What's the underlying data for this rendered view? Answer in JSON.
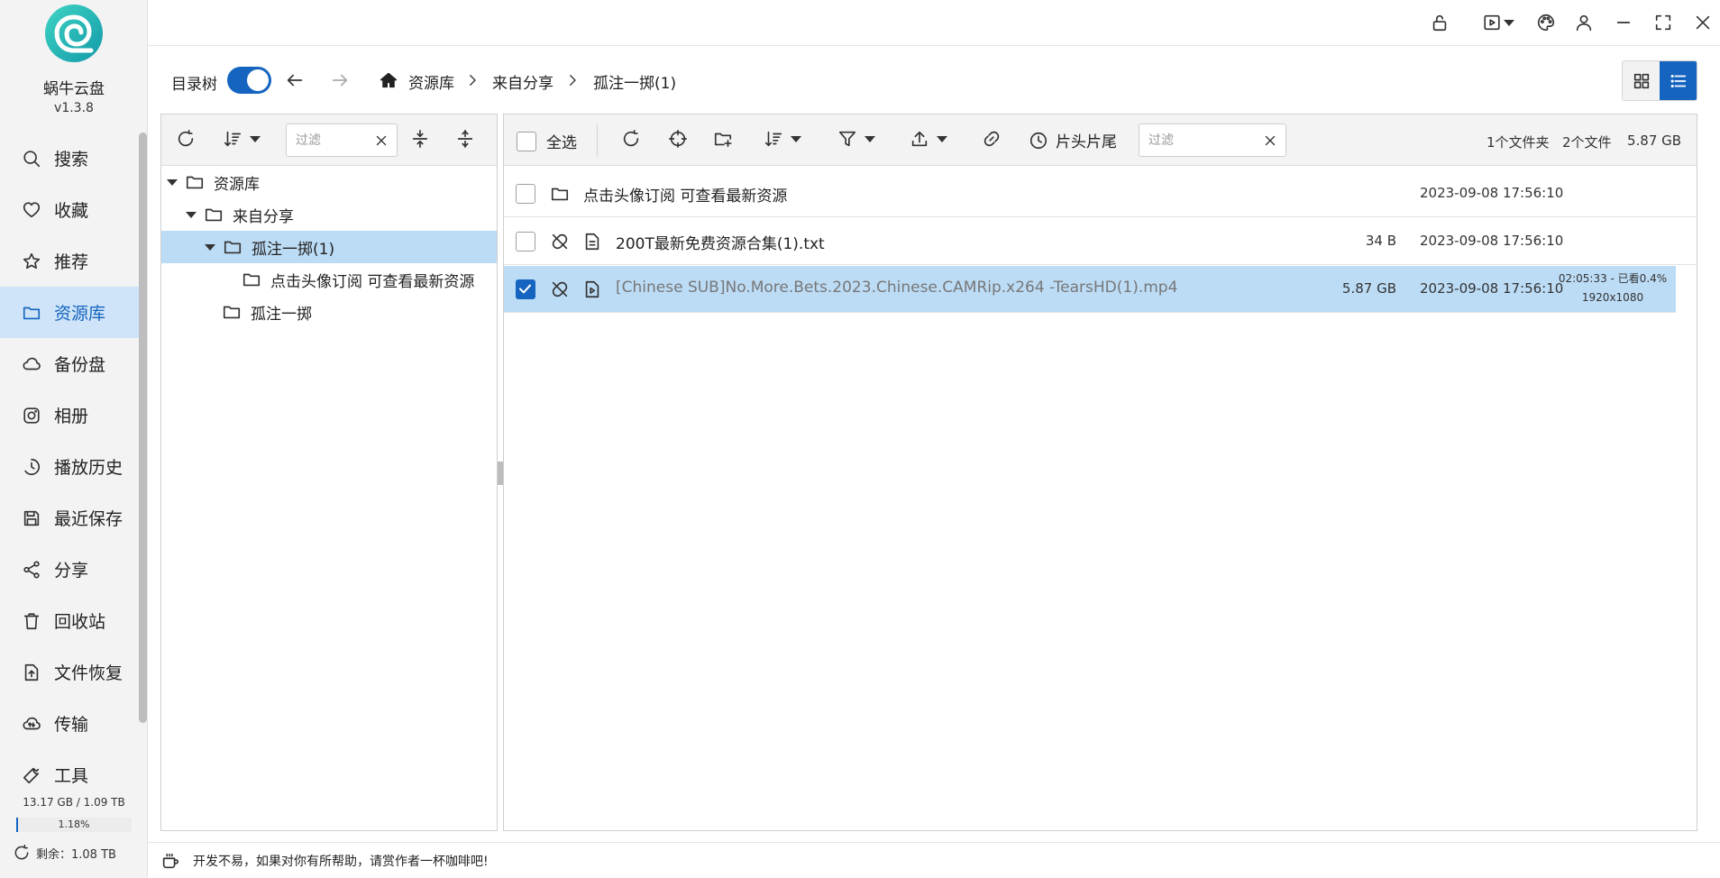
{
  "app": {
    "name": "蜗牛云盘",
    "version": "v1.3.8",
    "accent": "#1565c0"
  },
  "sidebar": {
    "items": [
      {
        "label": "搜索",
        "icon": "search-icon"
      },
      {
        "label": "收藏",
        "icon": "heart-icon"
      },
      {
        "label": "推荐",
        "icon": "star-icon"
      },
      {
        "label": "资源库",
        "icon": "folder-icon",
        "active": true
      },
      {
        "label": "备份盘",
        "icon": "cloud-icon"
      },
      {
        "label": "相册",
        "icon": "camera-icon"
      },
      {
        "label": "播放历史",
        "icon": "history-icon"
      },
      {
        "label": "最近保存",
        "icon": "save-icon"
      },
      {
        "label": "分享",
        "icon": "share-icon"
      },
      {
        "label": "回收站",
        "icon": "trash-icon"
      },
      {
        "label": "文件恢复",
        "icon": "file-restore-icon"
      },
      {
        "label": "传输",
        "icon": "transfer-icon"
      },
      {
        "label": "工具",
        "icon": "wrench-icon"
      }
    ],
    "storage": {
      "used_text": "13.17 GB / 1.09 TB",
      "percent_text": "1.18%",
      "percent": 1.18,
      "remaining": "剩余：1.08 TB"
    }
  },
  "titlebar": {
    "icons": [
      "lock-open-icon",
      "play-icon",
      "chevron-down-icon",
      "palette-icon",
      "user-icon",
      "minimize-icon",
      "maximize-icon",
      "close-icon"
    ]
  },
  "pathbar": {
    "tree_label": "目录树",
    "tree_enabled": true,
    "breadcrumb": [
      "资源库",
      "来自分享",
      "孤注一掷(1)"
    ]
  },
  "tree": {
    "filter_placeholder": "过滤",
    "nodes": [
      {
        "label": "资源库",
        "level": 0,
        "expanded": true
      },
      {
        "label": "来自分享",
        "level": 1,
        "expanded": true
      },
      {
        "label": "孤注一掷(1)",
        "level": 2,
        "expanded": true,
        "selected": true
      },
      {
        "label": "点击头像订阅 可查看最新资源",
        "level": 3
      },
      {
        "label": "孤注一掷",
        "level": 1
      }
    ]
  },
  "files": {
    "select_all_label": "全选",
    "intro_outro_label": "片头片尾",
    "filter_placeholder": "过滤",
    "folder_count": "1个文件夹",
    "file_count": "2个文件",
    "total_size": "5.87 GB",
    "rows": [
      {
        "name": "点击头像订阅 可查看最新资源",
        "type": "folder",
        "size": "",
        "date": "2023-09-08 17:56:10",
        "extra1": "",
        "extra2": "",
        "checked": false
      },
      {
        "name": "200T最新免费资源合集(1).txt",
        "type": "text",
        "size": "34 B",
        "date": "2023-09-08 17:56:10",
        "extra1": "",
        "extra2": "",
        "checked": false
      },
      {
        "name": "[Chinese SUB]No.More.Bets.2023.Chinese.CAMRip.x264 -TearsHD(1).mp4",
        "type": "video",
        "size": "5.87 GB",
        "date": "2023-09-08 17:56:10",
        "extra1": "02:05:33 - 已看0.4%",
        "extra2": "1920x1080",
        "checked": true
      }
    ]
  },
  "statusbar": {
    "text": "开发不易，如果对你有所帮助，请赏作者一杯咖啡吧!"
  }
}
